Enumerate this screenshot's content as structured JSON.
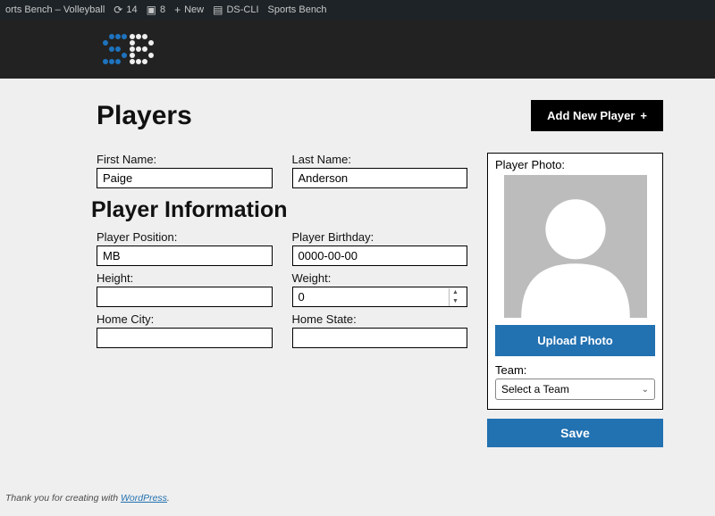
{
  "wp_bar": {
    "site_title": "orts Bench – Volleyball",
    "updates": "14",
    "comments": "8",
    "new": "New",
    "dscli": "DS-CLI",
    "sports_bench": "Sports Bench"
  },
  "page": {
    "title": "Players",
    "add_button": "Add New Player",
    "section_title": "Player Information"
  },
  "fields": {
    "first_name": {
      "label": "First Name:",
      "value": "Paige"
    },
    "last_name": {
      "label": "Last Name:",
      "value": "Anderson"
    },
    "position": {
      "label": "Player Position:",
      "value": "MB"
    },
    "birthday": {
      "label": "Player Birthday:",
      "value": "0000-00-00"
    },
    "height": {
      "label": "Height:",
      "value": ""
    },
    "weight": {
      "label": "Weight:",
      "value": "0"
    },
    "home_city": {
      "label": "Home City:",
      "value": ""
    },
    "home_state": {
      "label": "Home State:",
      "value": ""
    }
  },
  "sidebar": {
    "photo_label": "Player Photo:",
    "upload": "Upload Photo",
    "team_label": "Team:",
    "team_value": "Select a Team",
    "save": "Save"
  },
  "footer": {
    "text": "Thank you for creating with ",
    "link": "WordPress",
    "suffix": "."
  }
}
